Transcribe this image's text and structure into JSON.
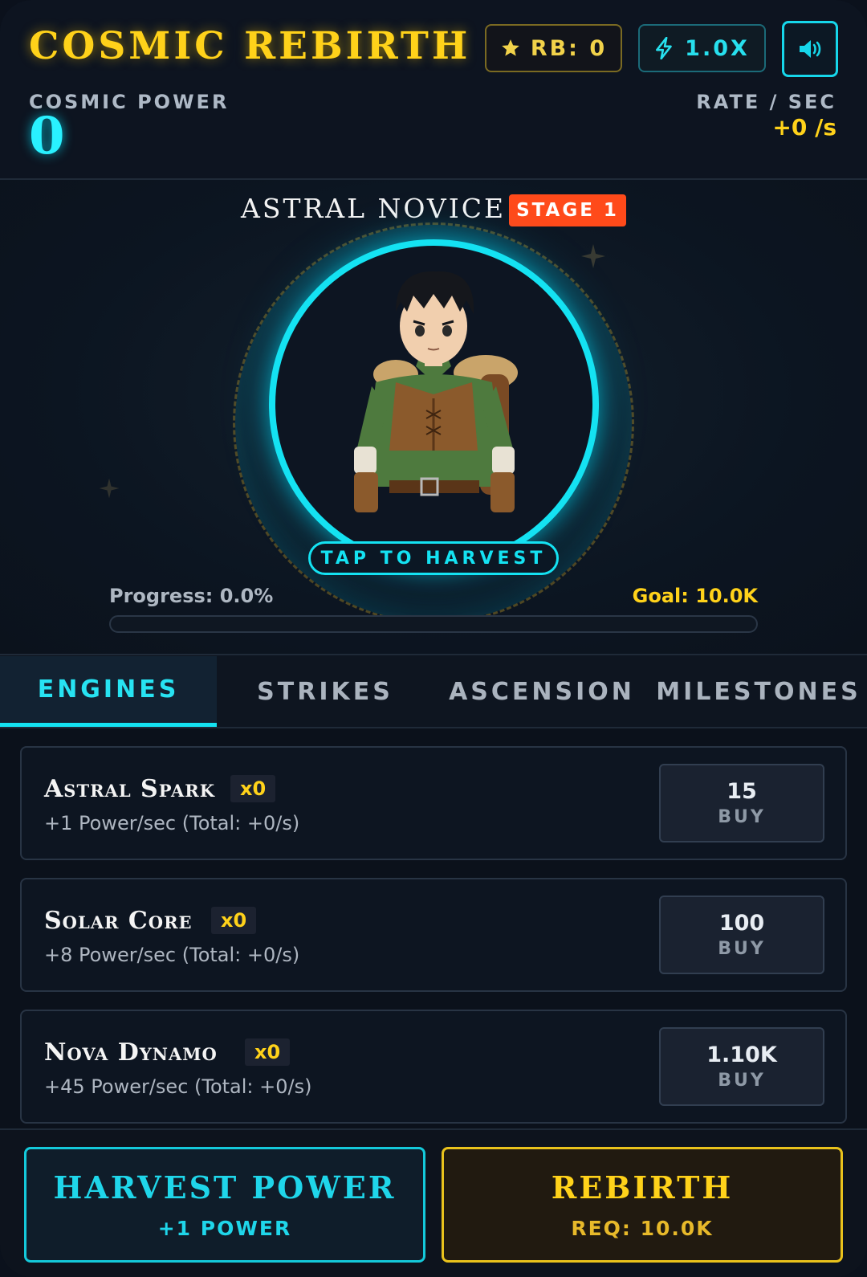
{
  "header": {
    "title": "COSMIC REBIRTH",
    "rebirth_badge": "RB: 0",
    "multiplier_badge": "1.0X",
    "power_label": "COSMIC POWER",
    "power_value": "0",
    "rate_label": "RATE / SEC",
    "rate_value": "+0 /s"
  },
  "hero": {
    "name": "ASTRAL NOVICE",
    "stage": "STAGE 1",
    "tap_label": "TAP TO HARVEST",
    "progress_label": "Progress: 0.0%",
    "progress_fraction": 0.0,
    "goal_label": "Goal: 10.0K"
  },
  "tabs": [
    {
      "label": "ENGINES",
      "active": true
    },
    {
      "label": "STRIKES",
      "active": false
    },
    {
      "label": "ASCENSION",
      "active": false
    },
    {
      "label": "MILESTONES",
      "active": false
    }
  ],
  "engines": [
    {
      "name": "Astral Spark",
      "owned": "x0",
      "desc": "+1 Power/sec (Total: +0/s)",
      "cost": "15",
      "buy_label": "BUY"
    },
    {
      "name": "Solar Core",
      "owned": "x0",
      "desc": "+8 Power/sec (Total: +0/s)",
      "cost": "100",
      "buy_label": "BUY"
    },
    {
      "name": "Nova Dynamo",
      "owned": "x0",
      "desc": "+45 Power/sec (Total: +0/s)",
      "cost": "1.10K",
      "buy_label": "BUY"
    }
  ],
  "footer": {
    "harvest_title": "HARVEST POWER",
    "harvest_sub": "+1 POWER",
    "rebirth_title": "REBIRTH",
    "rebirth_sub": "REQ: 10.0K"
  },
  "colors": {
    "accent_cyan": "#14e2f2",
    "accent_gold": "#ffd21a",
    "stage_orange": "#ff4a1a"
  },
  "icons": {
    "rebirth": "star-icon",
    "multiplier": "lightning-icon",
    "sound": "speaker-icon"
  }
}
